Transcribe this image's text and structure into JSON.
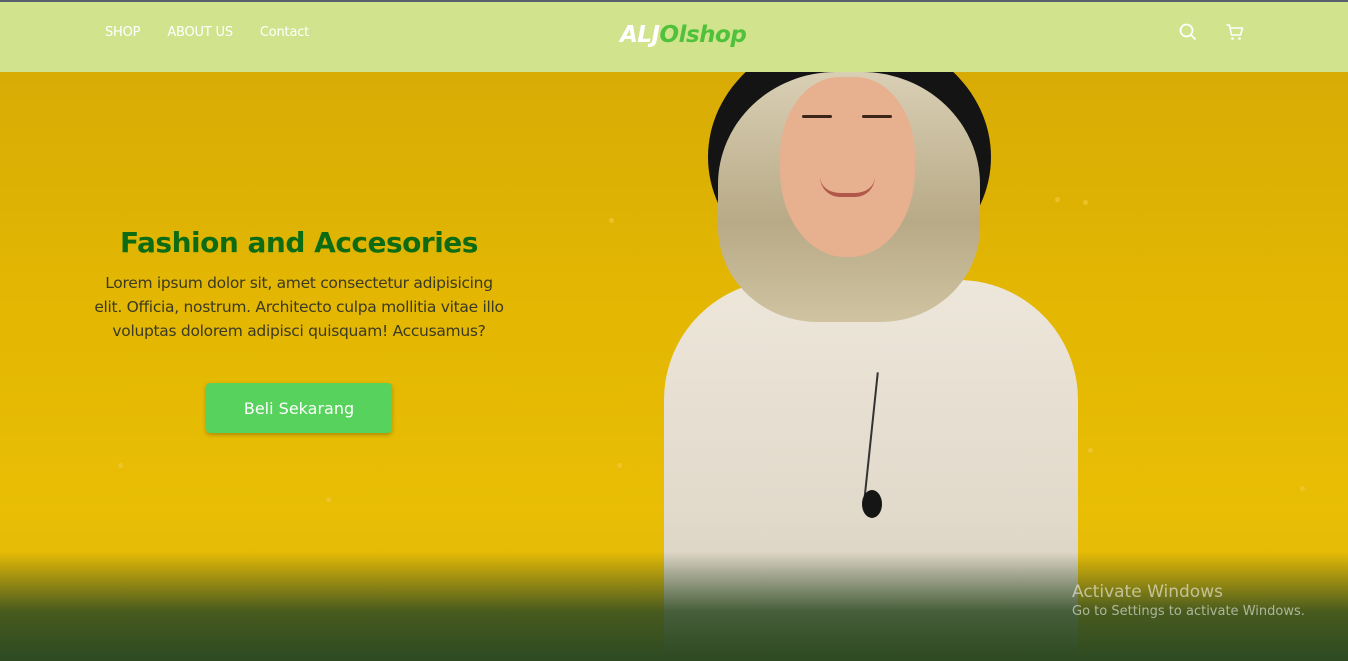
{
  "nav": {
    "links": [
      "SHOP",
      "ABOUT US",
      "Contact"
    ],
    "brand_part1": "ALJ",
    "brand_part2": "Olshop",
    "icons": [
      "search-icon",
      "cart-icon"
    ]
  },
  "hero": {
    "title": "Fashion and Accesories",
    "description": "Lorem ipsum dolor sit, amet consectetur adipisicing elit. Officia, nostrum. Architecto culpa mollitia vitae illo voluptas dolorem adipisci quisquam! Accusamus?",
    "cta_label": "Beli Sekarang"
  },
  "watermark": {
    "title": "Activate Windows",
    "subtitle": "Go to Settings to activate Windows."
  },
  "colors": {
    "navbar": "#d2e38e",
    "hero_background": "#e3b702",
    "title": "#0c6b13",
    "cta": "#57d25c",
    "brand_accent": "#4fc13a"
  }
}
